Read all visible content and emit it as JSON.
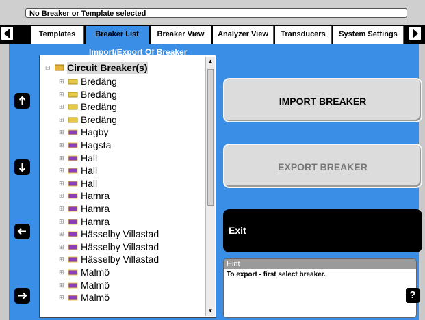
{
  "status": {
    "text": "No Breaker or Template selected"
  },
  "tabs": [
    {
      "label": "Templates"
    },
    {
      "label": "Breaker List"
    },
    {
      "label": "Breaker View"
    },
    {
      "label": "Analyzer View"
    },
    {
      "label": "Transducers"
    },
    {
      "label": "System Settings"
    }
  ],
  "active_tab": "Breaker List",
  "subtitle": "Import/Export Of Breaker",
  "tree": {
    "root": "Circuit Breaker(s)",
    "items": [
      "Bredäng",
      "Bredäng",
      "Bredäng",
      "Bredäng",
      "Hagby",
      "Hagsta",
      "Hall",
      "Hall",
      "Hall",
      "Hamra",
      "Hamra",
      "Hamra",
      "Hässelby Villastad",
      "Hässelby Villastad",
      "Hässelby Villastad",
      "Malmö",
      "Malmö",
      "Malmö"
    ]
  },
  "buttons": {
    "import": "IMPORT BREAKER",
    "export": "EXPORT BREAKER",
    "exit": "Exit",
    "help": "?"
  },
  "hint": {
    "title": "Hint",
    "text": "To export - first select breaker."
  },
  "colors": {
    "panel": "#3a8ee6",
    "active_tab": "#3a8ee6",
    "exit_bg": "#000000"
  }
}
